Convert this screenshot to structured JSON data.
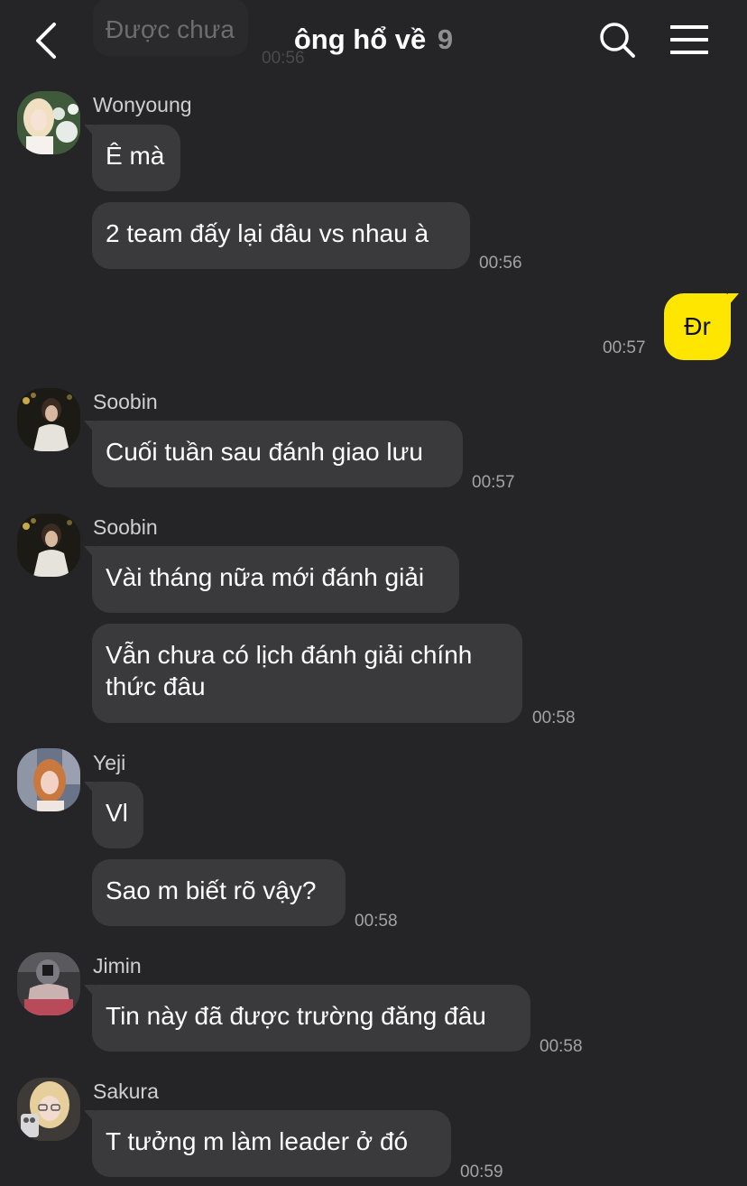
{
  "header": {
    "title": "ông hổ về",
    "member_count": "9",
    "back_icon": "chevron-left-icon",
    "search_icon": "search-icon",
    "menu_icon": "hamburger-menu-icon"
  },
  "scrolled_message": {
    "text": "Được chưa",
    "time": "00:56"
  },
  "messages": [
    {
      "sender": "Wonyoung",
      "bubbles": [
        "Ê mà",
        "2 team đấy lại đâu vs nhau à"
      ],
      "time": "00:56"
    },
    {
      "sender": "me",
      "bubbles": [
        "Đr"
      ],
      "time": "00:57"
    },
    {
      "sender": "Soobin",
      "bubbles": [
        "Cuối tuần sau đánh giao lưu"
      ],
      "time": "00:57"
    },
    {
      "sender": "Soobin",
      "bubbles": [
        "Vài tháng nữa mới đánh giải",
        "Vẫn chưa có lịch đánh giải chính thức đâu"
      ],
      "time": "00:58"
    },
    {
      "sender": "Yeji",
      "bubbles": [
        "Vl",
        "Sao m biết rõ vậy?"
      ],
      "time": "00:58"
    },
    {
      "sender": "Jimin",
      "bubbles": [
        "Tin này đã được trường đăng đâu"
      ],
      "time": "00:58"
    },
    {
      "sender": "Sakura",
      "bubbles": [
        "T tưởng m làm leader ở đó"
      ],
      "time": "00:59"
    }
  ],
  "colors": {
    "background": "#252527",
    "bubble_received": "#3a3a3c",
    "bubble_sent": "#ffe600"
  }
}
